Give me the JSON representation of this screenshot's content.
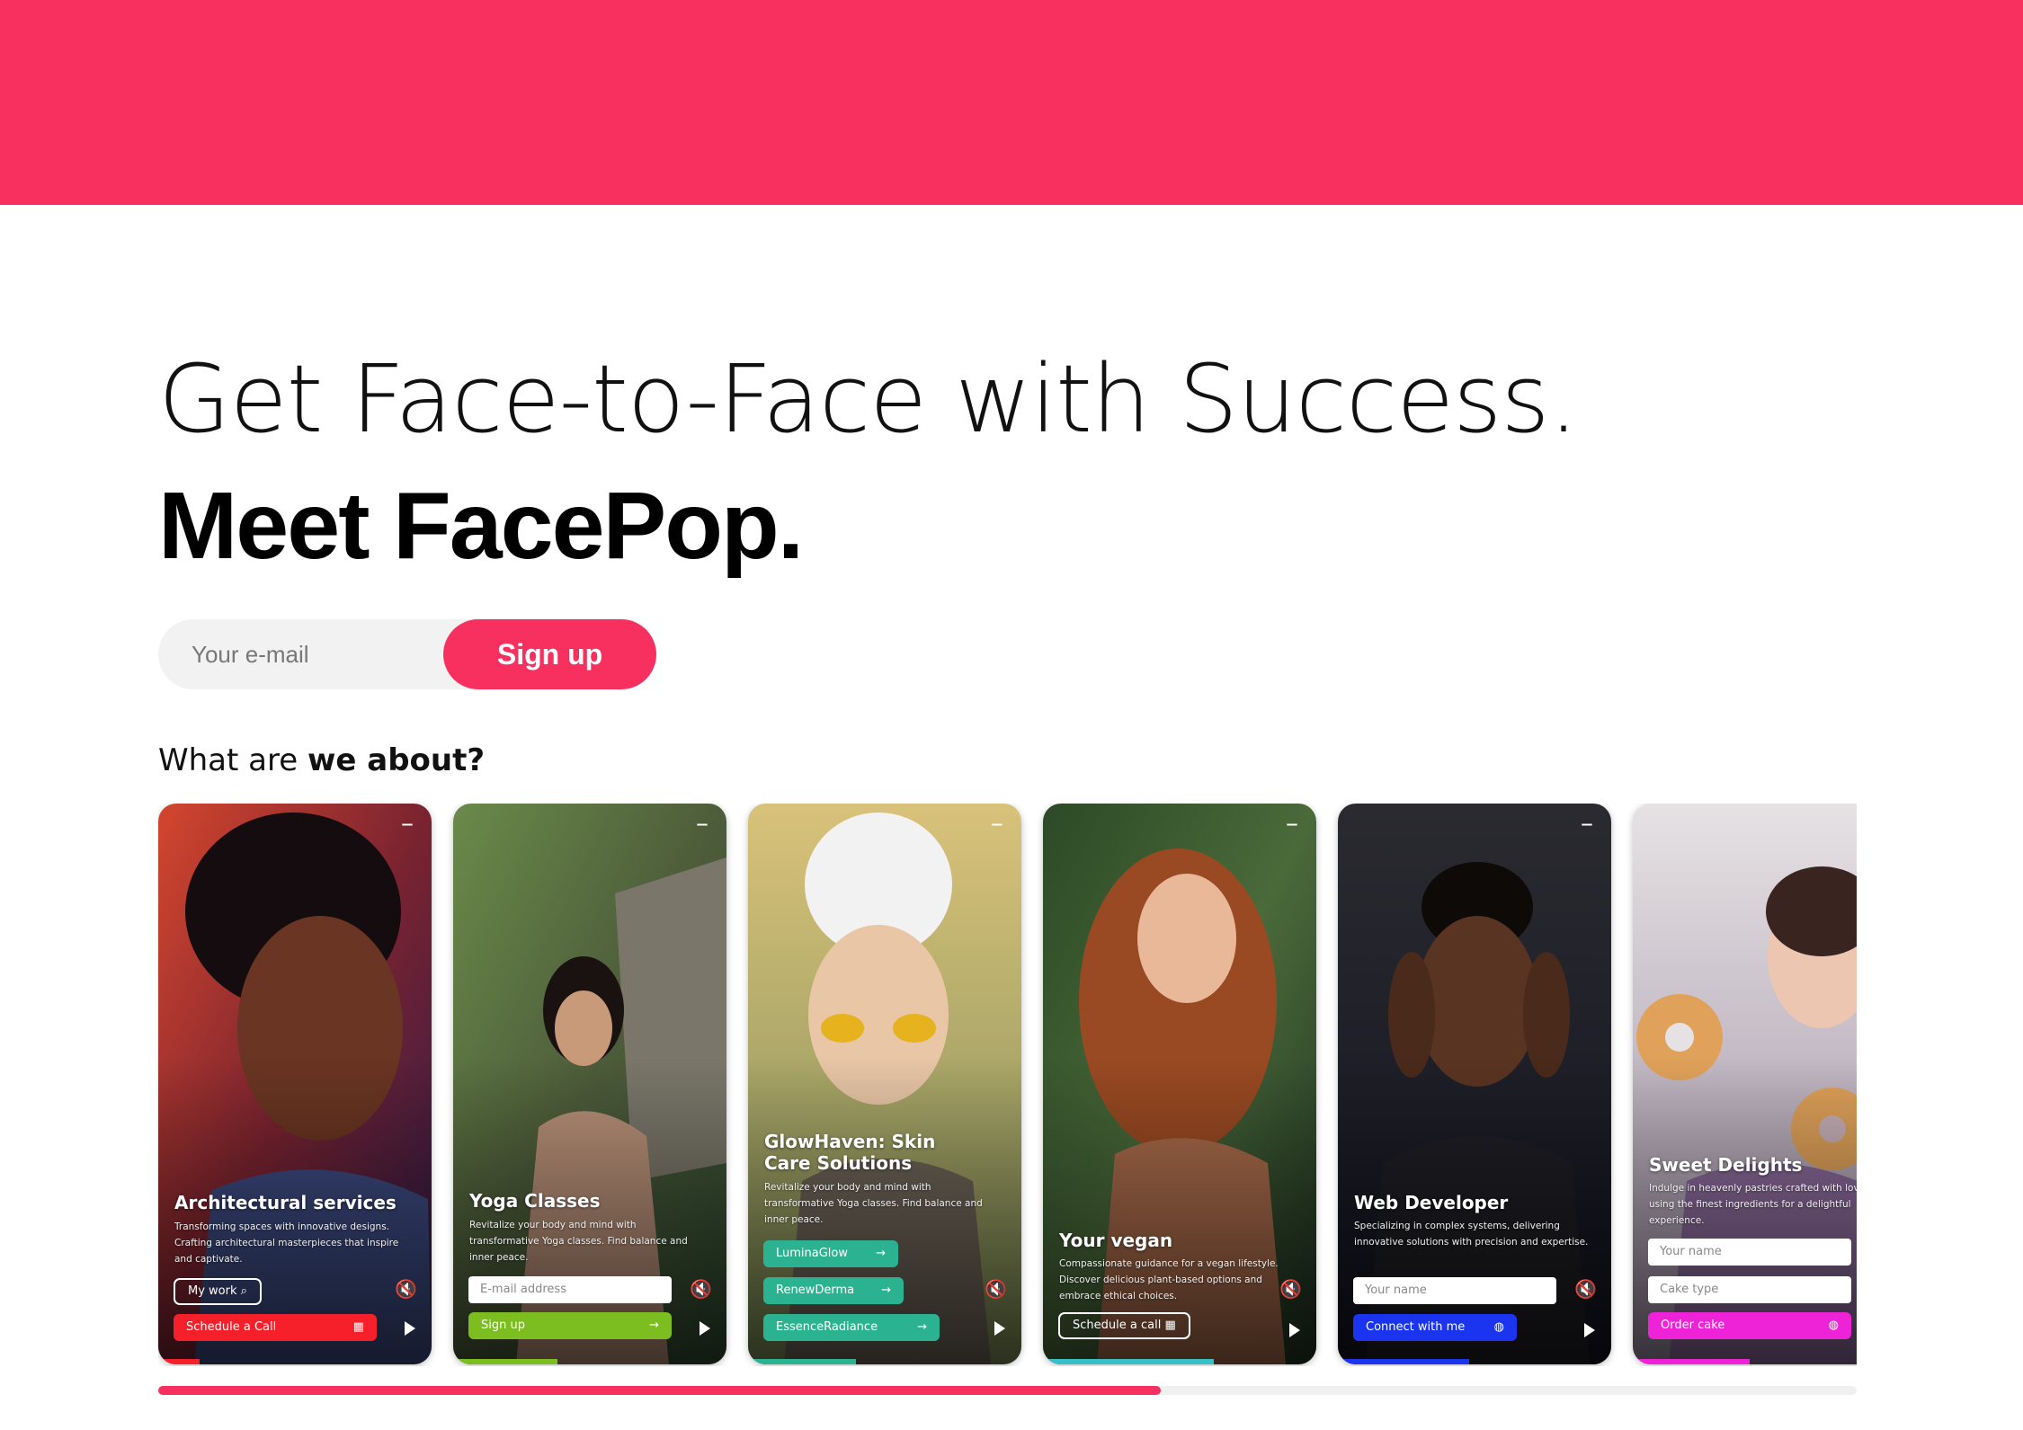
{
  "brand": {
    "accent": "#f7305f"
  },
  "hero": {
    "line1": "Get Face-to-Face with Success.",
    "line2": "Meet FacePop."
  },
  "signup": {
    "email_placeholder": "Your e-mail",
    "button_label": "Sign up"
  },
  "about": {
    "prefix": "What are ",
    "bold": "we about?"
  },
  "cards": [
    {
      "title": "Architectural services",
      "description": "Transforming spaces with innovative designs. Crafting architectural masterpieces that inspire and captivate.",
      "secondary_button": "My work",
      "primary_button": "Schedule a Call",
      "primary_color": "#f5202a"
    },
    {
      "title": "Yoga Classes",
      "description": "Revitalize your body and mind with transformative Yoga classes. Find balance and inner peace.",
      "field_placeholder": "E-mail address",
      "primary_button": "Sign up",
      "primary_color": "#7cbd1f"
    },
    {
      "title": "GlowHaven: Skin Care Solutions",
      "description": "Revitalize your body and mind with transformative Yoga classes. Find balance and inner peace.",
      "buttons": [
        "LuminaGlow",
        "RenewDerma",
        "EssenceRadiance"
      ],
      "primary_color": "#2bb391"
    },
    {
      "title": "Your vegan",
      "description": "Compassionate guidance for a vegan lifestyle. Discover delicious plant-based options and embrace ethical choices.",
      "secondary_button": "Schedule a call",
      "primary_color": "#38c0c9"
    },
    {
      "title": "Web Developer",
      "description": "Specializing in complex systems, delivering innovative solutions with precision and expertise.",
      "field_placeholder": "Your name",
      "primary_button": "Connect with me",
      "primary_color": "#1a34f0"
    },
    {
      "title": "Sweet Delights",
      "description": "Indulge in heavenly pastries crafted with love, using the finest ingredients for a delightful experience.",
      "field_placeholder": "Your name",
      "field2_placeholder": "Cake type",
      "primary_button": "Order cake",
      "primary_color": "#ee22d6"
    }
  ],
  "icons": {
    "minimize": "minimize-icon",
    "mute": "mute-icon",
    "play": "play-icon",
    "arrow": "arrow-right-icon",
    "calendar": "calendar-icon",
    "globe": "globe-icon",
    "attachment": "attachment-icon"
  },
  "carousel_progress": 0.59
}
